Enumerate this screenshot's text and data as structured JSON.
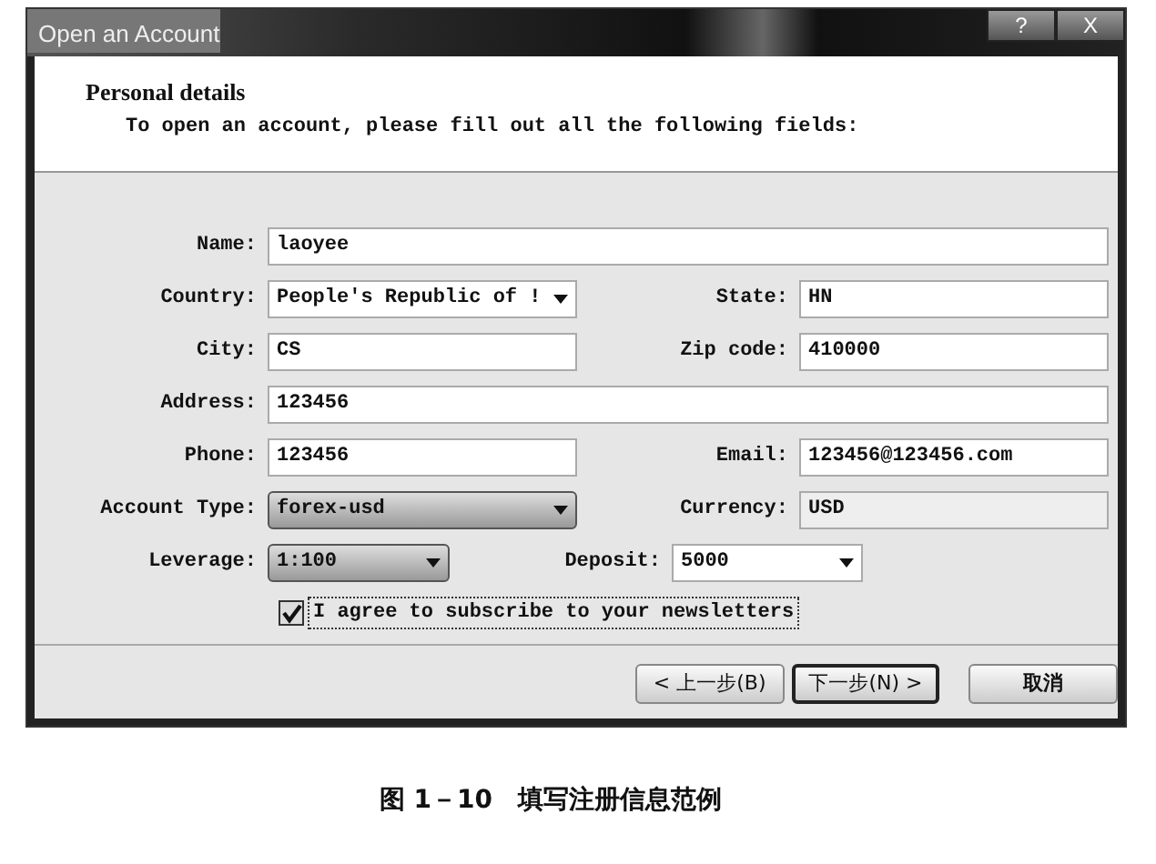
{
  "window": {
    "title": "Open an Account",
    "title_buttons": [
      "?",
      "X"
    ]
  },
  "header": {
    "title": "Personal details",
    "subtitle": "To open an account, please fill out all the following fields:"
  },
  "form_rows": [
    [
      {
        "label": "Name:",
        "value": "laoyee",
        "kind": "text"
      }
    ],
    [
      {
        "label": "Country:",
        "value": "People's Republic of !",
        "kind": "dropdown"
      },
      {
        "label": "State:",
        "value": "HN",
        "kind": "text"
      }
    ],
    [
      {
        "label": "City:",
        "value": "CS",
        "kind": "text"
      },
      {
        "label": "Zip code:",
        "value": "410000",
        "kind": "text"
      }
    ],
    [
      {
        "label": "Address:",
        "value": "123456",
        "kind": "text"
      }
    ],
    [
      {
        "label": "Phone:",
        "value": "123456",
        "kind": "text"
      },
      {
        "label": "Email:",
        "value": "123456@123456.com",
        "kind": "text"
      }
    ],
    [
      {
        "label": "Account Type:",
        "value": "forex-usd",
        "kind": "combo"
      },
      {
        "label": "Currency:",
        "value": "USD",
        "kind": "readonly"
      }
    ],
    [
      {
        "label": "Leverage:",
        "value": "1:100",
        "kind": "combo"
      },
      {
        "label": "Deposit:",
        "value": "5000",
        "kind": "dropdown"
      }
    ]
  ],
  "newsletter": {
    "label": "I agree to subscribe to your newsletters",
    "checked": true
  },
  "buttons": [
    {
      "label": "< 上一步(B)",
      "focused": false
    },
    {
      "label": "下一步(N) >",
      "focused": true
    },
    {
      "label": "取消",
      "focused": false
    }
  ],
  "caption": "图 1－10　填写注册信息范例"
}
